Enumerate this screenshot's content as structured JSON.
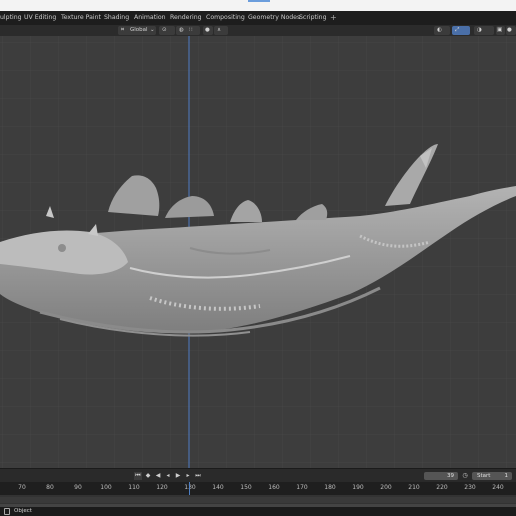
{
  "workspace_tabs": [
    {
      "label": "ulpting"
    },
    {
      "label": "UV Editing"
    },
    {
      "label": "Texture Paint"
    },
    {
      "label": "Shading"
    },
    {
      "label": "Animation"
    },
    {
      "label": "Rendering"
    },
    {
      "label": "Compositing"
    },
    {
      "label": "Geometry Nodes"
    },
    {
      "label": "Scripting"
    }
  ],
  "add_tab_label": "+",
  "header": {
    "transform_orientation": "Global",
    "dropdown_icon": "chevron-down-icon"
  },
  "timeline": {
    "current_frame": "39",
    "start_label": "Start",
    "start_value": "1",
    "ruler_ticks": [
      "70",
      "80",
      "90",
      "100",
      "110",
      "120",
      "130",
      "140",
      "150",
      "160",
      "170",
      "180",
      "190",
      "200",
      "210",
      "220",
      "230",
      "240"
    ]
  },
  "status": {
    "mode_label": "Object"
  },
  "colors": {
    "viewport_bg": "#3d3d3d",
    "grid_line": "#474747",
    "axis_blue": "#4f7ac2",
    "playhead_blue": "#4d7fc4",
    "mesh_gray": "#a6a6a6"
  }
}
